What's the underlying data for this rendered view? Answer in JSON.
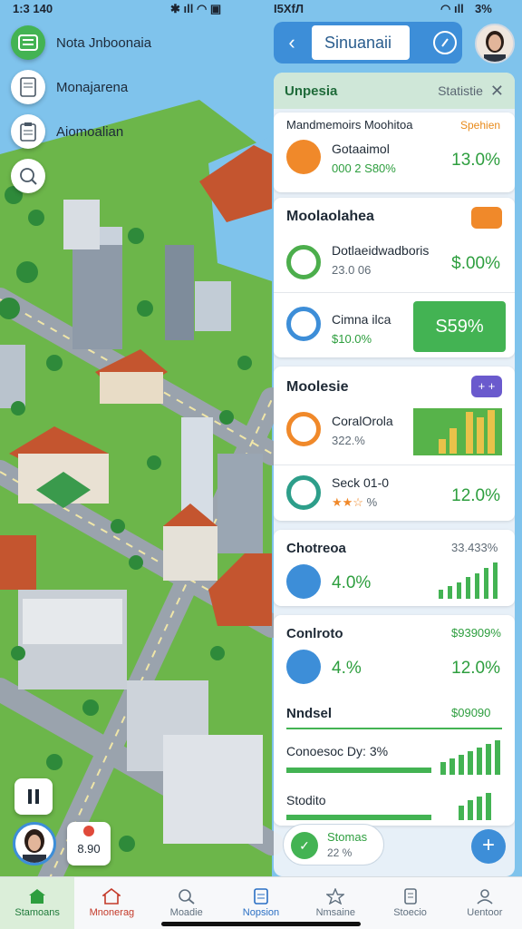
{
  "status_bar": {
    "time": "1:3 140",
    "center": "I5XfЛ",
    "battery": "3%"
  },
  "left_chips": [
    {
      "label": "Nota Jnboonaia",
      "icon": "list-icon"
    },
    {
      "label": "Monajarena",
      "icon": "document-icon"
    },
    {
      "label": "Aiomoalian",
      "icon": "clipboard-icon"
    },
    {
      "label": "",
      "icon": "magnifier-icon"
    }
  ],
  "search": {
    "value": "Sinuanaii",
    "icon": "compass-icon"
  },
  "panel": {
    "title": "Unpesia",
    "subtitle": "Statistie",
    "top_card": {
      "title": "Mandmemoirs Moohitoa",
      "tag": "Spehien",
      "name": "Gotaaimol",
      "sub": "000 2 S80%",
      "value": "13.0%"
    },
    "section1": {
      "title": "Moolaolahea",
      "rows": [
        {
          "name": "Dotlaeidwadboris",
          "sub": "23.0 06",
          "value": "$.00%"
        },
        {
          "name": "Cimna ilca",
          "sub": "$10.0%",
          "value": "S59%"
        }
      ]
    },
    "section2": {
      "title": "Moolesie",
      "badge": "+ +",
      "rows": [
        {
          "name": "CoralOrola",
          "sub": "322.%"
        },
        {
          "name": "Seck 01-0",
          "sub": "%",
          "value": "12.0%"
        }
      ]
    },
    "section3": {
      "title": "Chotreoa",
      "tag": "33.433%",
      "value": "4.0%"
    },
    "section4": {
      "title": "Conlroto",
      "tag": "$93909%",
      "sub": "4.%",
      "value": "12.0%",
      "line2_title": "Nndsel",
      "line2_tag": "$09090",
      "line3": "Conoesoc Dy: 3%",
      "line4": "Stodito"
    },
    "footer_chip": {
      "name": "Stomas",
      "sub": "22 %"
    }
  },
  "bottom_left": {
    "badge_value": "8.90",
    "icon": "pause-icon"
  },
  "bottom_nav": [
    {
      "label": "Stamoans",
      "icon": "home-icon",
      "active": true
    },
    {
      "label": "Mnonerag",
      "icon": "house-outline-icon",
      "active": false
    },
    {
      "label": "Moadie",
      "icon": "search-icon",
      "active": false
    },
    {
      "label": "Nopsion",
      "icon": "clipboard-icon",
      "active": false
    },
    {
      "label": "Nmsaine",
      "icon": "star-icon",
      "active": false
    },
    {
      "label": "Stoecio",
      "icon": "notes-icon",
      "active": false
    },
    {
      "label": "Uentoor",
      "icon": "person-icon",
      "active": false
    }
  ],
  "colors": {
    "accent": "#3d8ed8",
    "positive": "#2d9e3e",
    "warning": "#f0892a",
    "purple": "#6a5acd"
  }
}
